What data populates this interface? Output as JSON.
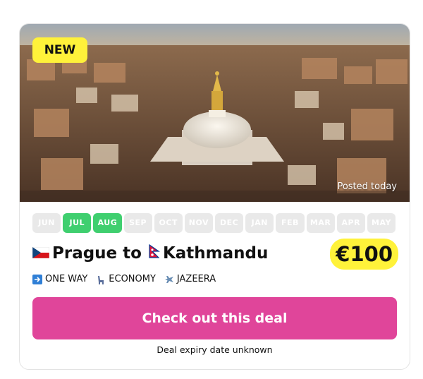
{
  "badge": "NEW",
  "posted": "Posted today",
  "months": [
    {
      "label": "JUN",
      "active": false
    },
    {
      "label": "JUL",
      "active": true
    },
    {
      "label": "AUG",
      "active": true
    },
    {
      "label": "SEP",
      "active": false
    },
    {
      "label": "OCT",
      "active": false
    },
    {
      "label": "NOV",
      "active": false
    },
    {
      "label": "DEC",
      "active": false
    },
    {
      "label": "JAN",
      "active": false
    },
    {
      "label": "FEB",
      "active": false
    },
    {
      "label": "MAR",
      "active": false
    },
    {
      "label": "APR",
      "active": false
    },
    {
      "label": "MAY",
      "active": false
    }
  ],
  "route": {
    "origin": "Prague to",
    "destination": "Kathmandu",
    "origin_flag": "czech-flag-icon",
    "destination_flag": "nepal-flag-icon"
  },
  "price": "€100",
  "tags": {
    "trip_type": "ONE WAY",
    "cabin": "ECONOMY",
    "airline": "JAZEERA"
  },
  "cta_label": "Check out this deal",
  "expiry": "Deal expiry date unknown",
  "colors": {
    "accent": "#e0459a",
    "highlight": "#fff23a",
    "active_month": "#3fcf6f",
    "inactive_month": "#e9e9e9"
  }
}
